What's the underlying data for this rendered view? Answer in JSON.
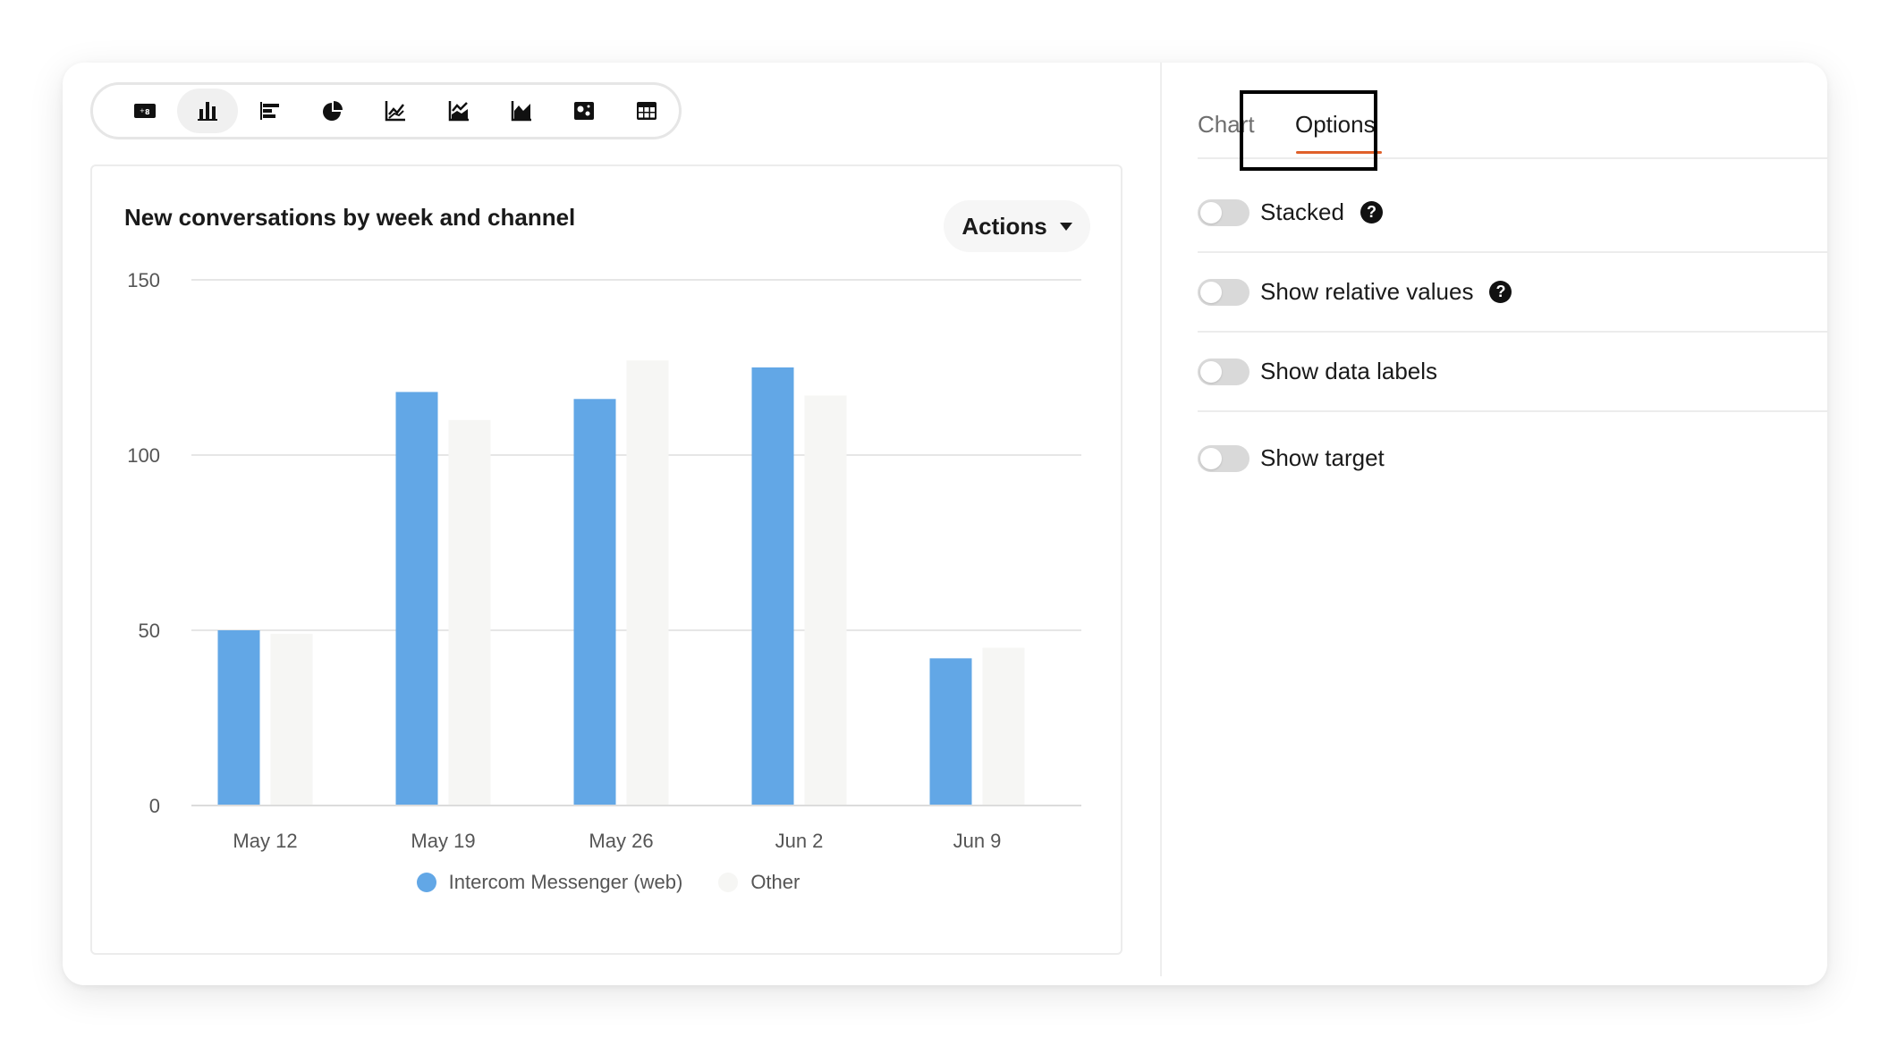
{
  "toolbar": {
    "chart_types": [
      {
        "icon": "number-card-icon",
        "active": false
      },
      {
        "icon": "column-chart-icon",
        "active": true
      },
      {
        "icon": "horizontal-bar-chart-icon",
        "active": false
      },
      {
        "icon": "pie-chart-icon",
        "active": false
      },
      {
        "icon": "line-chart-icon",
        "active": false
      },
      {
        "icon": "line-area-chart-icon",
        "active": false
      },
      {
        "icon": "area-chart-icon",
        "active": false
      },
      {
        "icon": "heatmap-icon",
        "active": false
      },
      {
        "icon": "table-icon",
        "active": false
      }
    ]
  },
  "panel": {
    "title": "New conversations by week and channel",
    "actions_label": "Actions"
  },
  "chart_data": {
    "type": "bar",
    "title": "New conversations by week and channel",
    "categories": [
      "May 12",
      "May 19",
      "May 26",
      "Jun 2",
      "Jun 9"
    ],
    "series": [
      {
        "name": "Intercom Messenger (web)",
        "values": [
          50,
          118,
          116,
          125,
          42
        ],
        "color": "#62a7e6"
      },
      {
        "name": "Other",
        "values": [
          49,
          110,
          127,
          117,
          45
        ],
        "color": "#f6f6f4"
      }
    ],
    "y_ticks": [
      "0",
      "50",
      "100",
      "150"
    ],
    "ylim": [
      0,
      150
    ],
    "grid": true,
    "legend": "bottom-center"
  },
  "tabs": [
    {
      "label": "Chart",
      "active": false
    },
    {
      "label": "Options",
      "active": true
    }
  ],
  "options": [
    {
      "label": "Stacked",
      "enabled": false,
      "help": true
    },
    {
      "label": "Show relative values",
      "enabled": false,
      "help": true
    },
    {
      "label": "Show data labels",
      "enabled": false,
      "help": false
    },
    {
      "label": "Show target",
      "enabled": false,
      "help": false
    }
  ],
  "colors": {
    "accent": "#e0602a",
    "series_primary": "#62a7e6",
    "series_secondary": "#f6f6f4"
  }
}
